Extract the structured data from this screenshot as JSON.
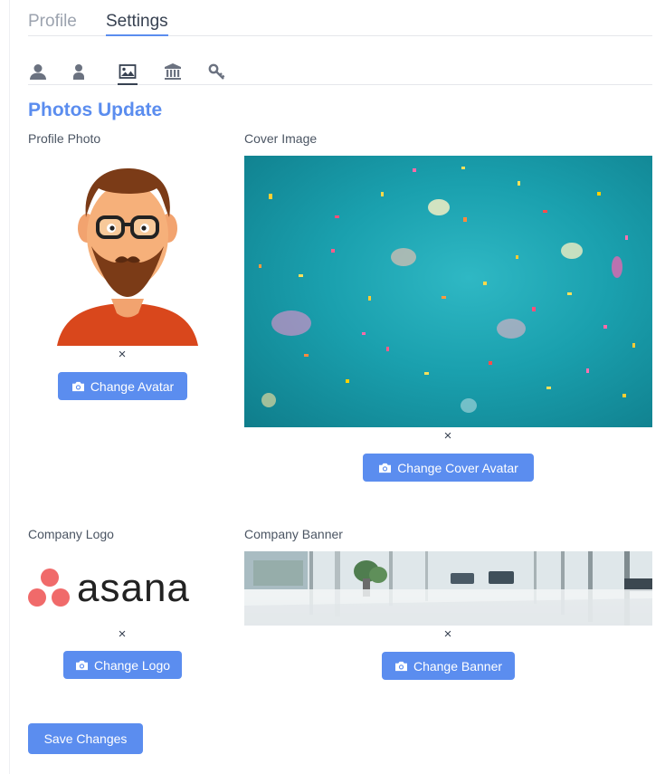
{
  "tabs": [
    {
      "label": "Profile"
    },
    {
      "label": "Settings"
    }
  ],
  "icon_tabs": [
    "user-icon",
    "user-alt-icon",
    "image-icon",
    "bank-icon",
    "key-icon"
  ],
  "section_title": "Photos Update",
  "profile_photo": {
    "label": "Profile Photo",
    "remove": "×",
    "button": "Change Avatar"
  },
  "cover_image": {
    "label": "Cover Image",
    "remove": "×",
    "button": "Change Cover Avatar"
  },
  "company_logo": {
    "label": "Company Logo",
    "remove": "×",
    "button": "Change Logo",
    "logo_text": "asana"
  },
  "company_banner": {
    "label": "Company Banner",
    "remove": "×",
    "button": "Change Banner"
  },
  "save_button": "Save Changes",
  "colors": {
    "accent": "#5b8def",
    "logo_dots": "#f06a6a"
  }
}
